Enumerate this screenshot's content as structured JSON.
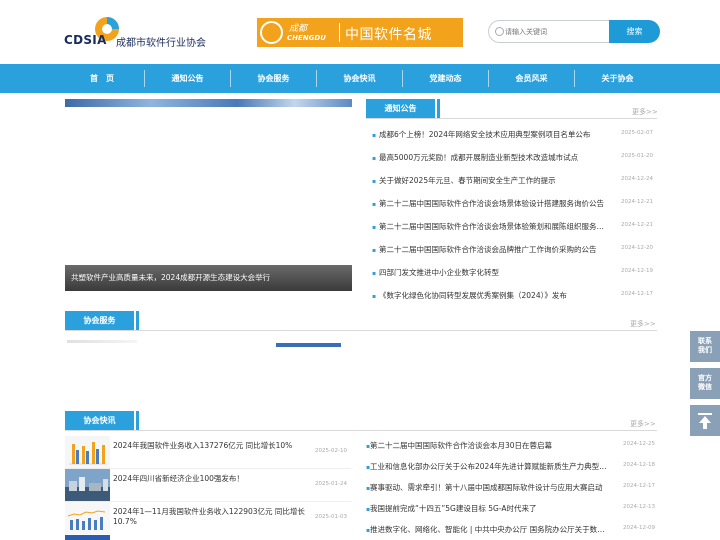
{
  "header": {
    "logo_abbr": "CDSIA",
    "logo_cn": "成都市软件行业协会",
    "banner_small_cn": "成都",
    "banner_small_en": "CHENGDU",
    "banner_text": "中国软件名城",
    "search_placeholder": "请输入关键词",
    "search_button": "搜索"
  },
  "nav": [
    "首　页",
    "通知公告",
    "协会服务",
    "协会快讯",
    "党建动态",
    "会员风采",
    "关于协会"
  ],
  "hero": {
    "caption": "共塑软件产业高质量未来，2024成都开源生态建设大会举行"
  },
  "notices": {
    "title": "通知公告",
    "more": "更多>>",
    "items": [
      {
        "title": "成都6个上榜！2024年网络安全技术应用典型案例项目名单公布",
        "date": "2025-02-07"
      },
      {
        "title": "最高5000万元奖励！成都开展制造业新型技术改造城市试点",
        "date": "2025-01-20"
      },
      {
        "title": "关于做好2025年元旦、春节期间安全生产工作的提示",
        "date": "2024-12-24"
      },
      {
        "title": "第二十二届中国国际软件合作洽谈会场景体验设计搭建服务询价公告",
        "date": "2024-12-21"
      },
      {
        "title": "第二十二届中国国际软件合作洽谈会场景体验策划和展陈组织服务询价公告",
        "date": "2024-12-21"
      },
      {
        "title": "第二十二届中国国际软件合作洽谈会品牌推广工作询价采购的公告",
        "date": "2024-12-20"
      },
      {
        "title": "四部门发文推进中小企业数字化转型",
        "date": "2024-12-19"
      },
      {
        "title": "《数字化绿色化协同转型发展优秀案例集（2024）》发布",
        "date": "2024-12-17"
      }
    ]
  },
  "services": {
    "title": "协会服务",
    "more": "更多>>"
  },
  "news": {
    "title": "协会快讯",
    "more": "更多>>",
    "left_items": [
      {
        "title": "2024年我国软件业务收入137276亿元 同比增长10%",
        "date": "2025-02-10"
      },
      {
        "title": "2024年四川省新经济企业100强发布！",
        "date": "2025-01-24"
      },
      {
        "title": "2024年1—11月我国软件业务收入122903亿元 同比增长10.7%",
        "date": "2025-01-03"
      }
    ],
    "right_items": [
      {
        "title": "第二十二届中国国际软件合作洽谈会本月30日在蓉启幕",
        "date": "2024-12-25"
      },
      {
        "title": "工业和信息化部办公厅关于公布2024年先进计算赋能新质生产力典型应用案例名单的通知",
        "date": "2024-12-18"
      },
      {
        "title": "赛事驱动、需求牵引！第十八届中国成都国际软件设计与应用大赛启动",
        "date": "2024-12-17"
      },
      {
        "title": "我国提前完成“十四五”5G建设目标 5G-A时代来了",
        "date": "2024-12-13"
      },
      {
        "title": "推进数字化、网络化、智能化 | 中共中央办公厅 国务院办公厅关于数字中国建设",
        "date": "2024-12-09"
      }
    ]
  },
  "float": {
    "contact": [
      "联系",
      "我们"
    ],
    "official": [
      "官方",
      "微信"
    ]
  },
  "colors": {
    "nav_blue": "#2aa1dd",
    "banner_orange": "#f2a31b",
    "float_gray": "#8aa0b6"
  }
}
